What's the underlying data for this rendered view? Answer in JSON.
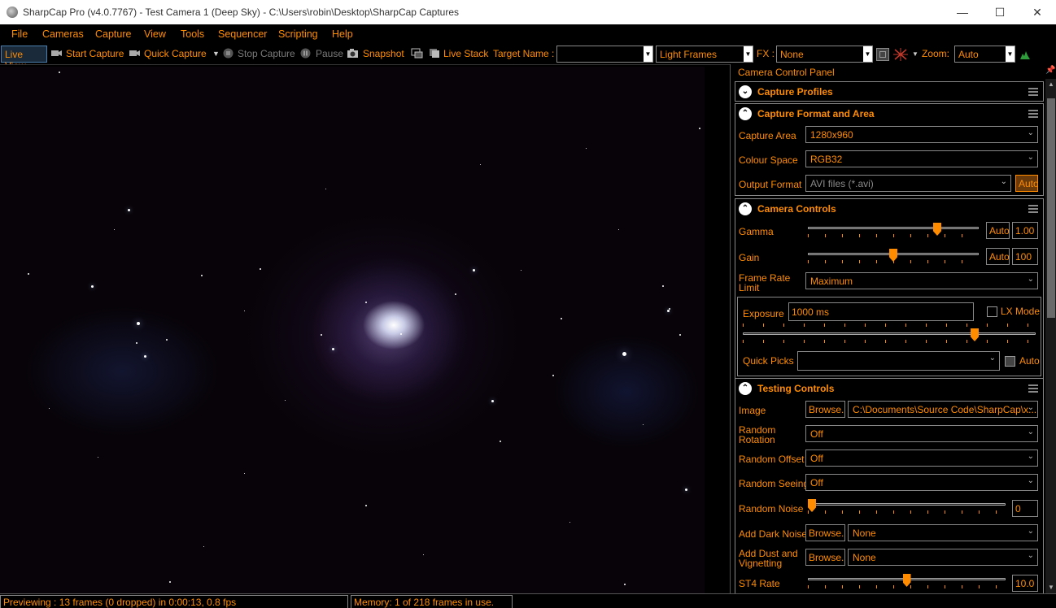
{
  "window": {
    "title": "SharpCap Pro (v4.0.7767) - Test Camera 1 (Deep Sky) - C:\\Users\\robin\\Desktop\\SharpCap Captures",
    "minimize": "—",
    "maximize": "☐",
    "close": "✕"
  },
  "menu": [
    "File",
    "Cameras",
    "Capture",
    "View",
    "Tools",
    "Sequencer",
    "Scripting",
    "Help"
  ],
  "toolbar": {
    "live_view": "Live View",
    "start_capture": "Start Capture",
    "quick_capture": "Quick Capture",
    "stop_capture": "Stop Capture",
    "pause": "Pause",
    "snapshot": "Snapshot",
    "live_stack": "Live Stack",
    "target_name_label": "Target Name :",
    "target_name_value": "",
    "frame_type": "Light Frames",
    "fx_label": "FX :",
    "fx_value": "None",
    "zoom_label": "Zoom:",
    "zoom_value": "Auto"
  },
  "panel": {
    "title": "Camera Control Panel",
    "capture_profiles": {
      "title": "Capture Profiles"
    },
    "capture_format": {
      "title": "Capture Format and Area",
      "capture_area_label": "Capture Area",
      "capture_area_value": "1280x960",
      "colour_space_label": "Colour Space",
      "colour_space_value": "RGB32",
      "output_format_label": "Output Format",
      "output_format_value": "AVI files (*.avi)",
      "auto": "Auto"
    },
    "camera_controls": {
      "title": "Camera Controls",
      "gamma_label": "Gamma",
      "gamma_auto": "Auto",
      "gamma_value": "1.00",
      "gamma_level": 0.77,
      "gain_label": "Gain",
      "gain_auto": "Auto",
      "gain_value": "100",
      "gain_level": 0.5,
      "frame_rate_label": "Frame Rate Limit",
      "frame_rate_value": "Maximum",
      "exposure_label": "Exposure",
      "exposure_value": "1000 ms",
      "exposure_level": 0.8,
      "lx_mode": "LX Mode",
      "quick_picks_label": "Quick Picks",
      "quick_picks_value": "",
      "auto": "Auto"
    },
    "testing_controls": {
      "title": "Testing Controls",
      "image_label": "Image",
      "browse": "Browse...",
      "image_path": "C:\\Documents\\Source Code\\SharpCap\\x...",
      "random_rotation_label": "Random Rotation",
      "random_rotation_value": "Off",
      "random_offset_label": "Random Offset",
      "random_offset_value": "Off",
      "random_seeing_label": "Random Seeing",
      "random_seeing_value": "Off",
      "random_noise_label": "Random Noise",
      "random_noise_value": "0",
      "random_noise_level": 0.0,
      "dark_noise_label": "Add Dark Noise",
      "dark_noise_value": "None",
      "dust_label": "Add Dust and Vignetting",
      "dust_value": "None",
      "st4_label": "ST4 Rate",
      "st4_value": "10.0",
      "st4_level": 0.5
    }
  },
  "status": {
    "preview": "Previewing : 13 frames (0 dropped) in 0:00:13, 0.8 fps",
    "memory": "Memory: 1 of 218 frames in use."
  },
  "colors": {
    "accent": "#ff8c00",
    "background": "#000000",
    "disabled": "#7a7a7a"
  }
}
